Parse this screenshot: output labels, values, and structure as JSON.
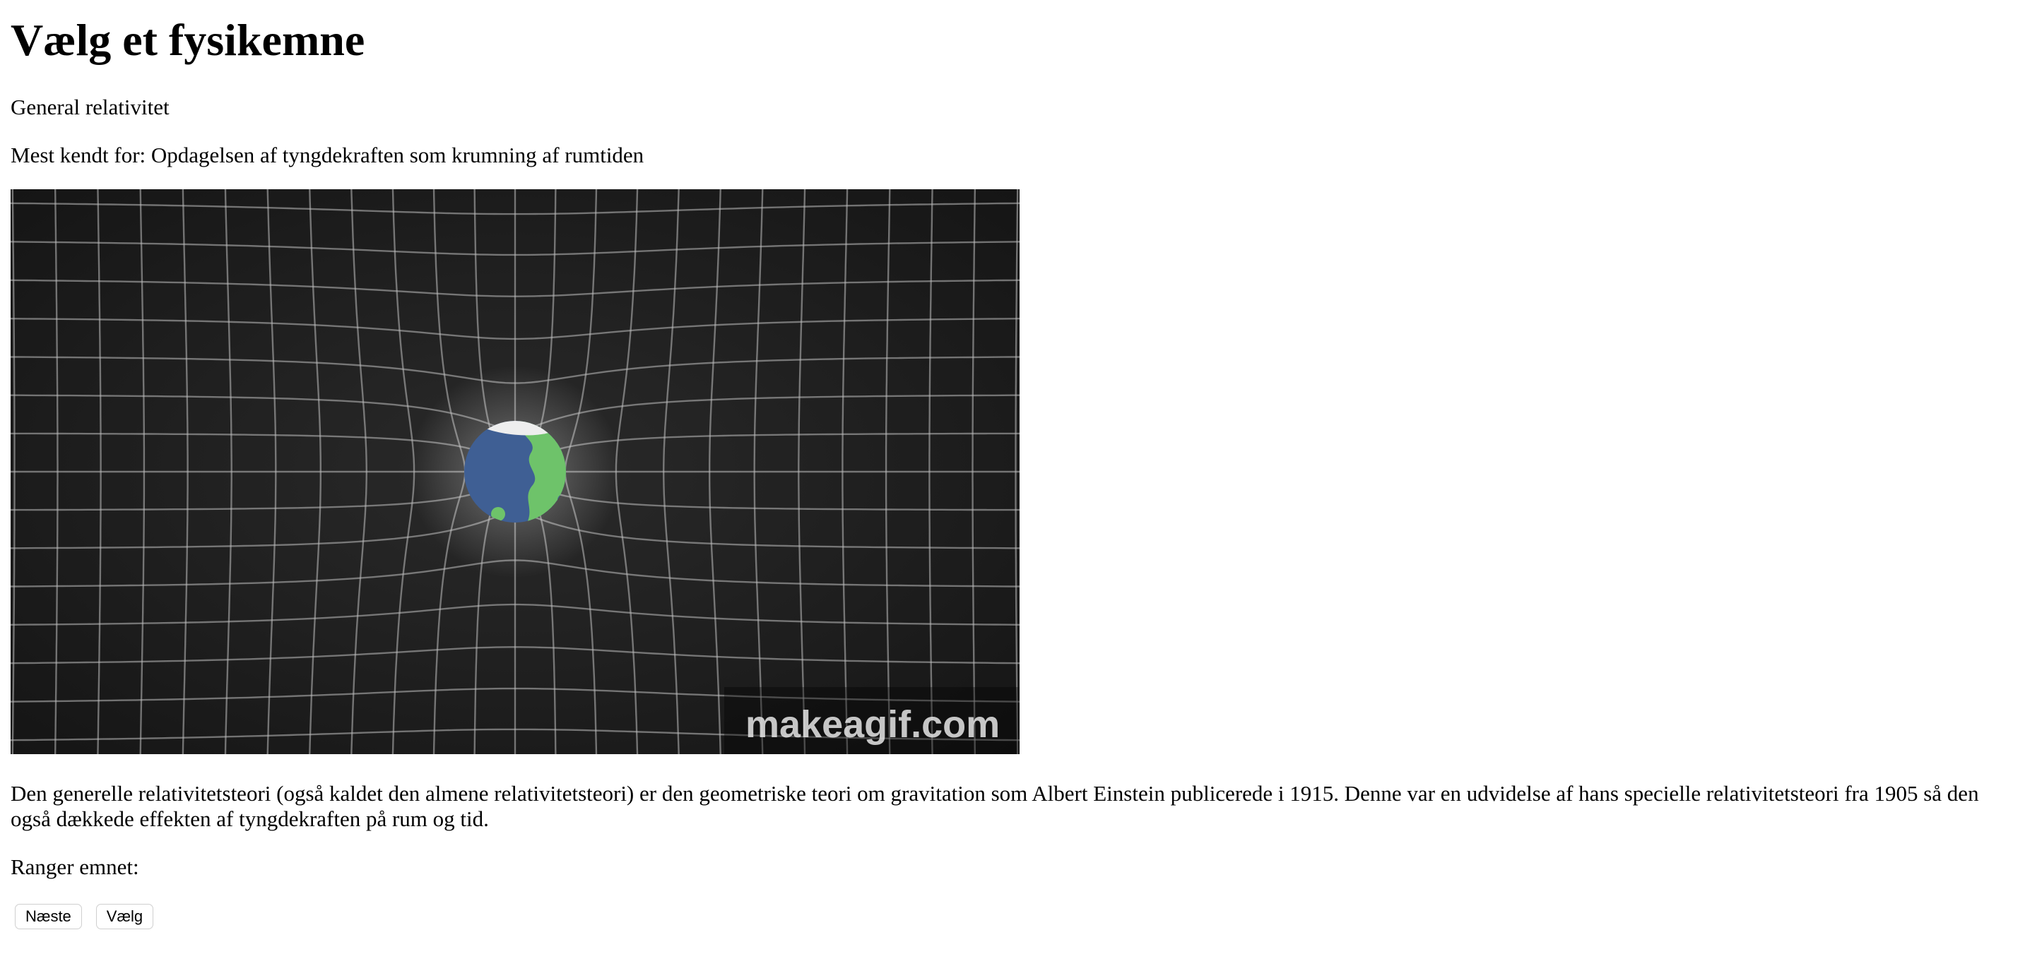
{
  "page": {
    "title": "Vælg et fysikemne",
    "subject_name": "General relativitet",
    "known_for": "Mest kendt for: Opdagelsen af tyngdekraften som krumning af rumtiden",
    "image": {
      "icon": "earth-icon",
      "watermark": "makeagif.com"
    },
    "description": "Den generelle relativitetsteori (også kaldet den almene relativitetsteori) er den geometriske teori om gravitation som Albert Einstein publicerede i 1915. Denne var en udvidelse af hans specielle relativitetsteori fra 1905 så den også dækkede effekten af tyngdekraften på rum og tid.",
    "rank_label": "Ranger emnet:",
    "buttons": {
      "next_label": "Næste",
      "select_label": "Vælg"
    }
  }
}
